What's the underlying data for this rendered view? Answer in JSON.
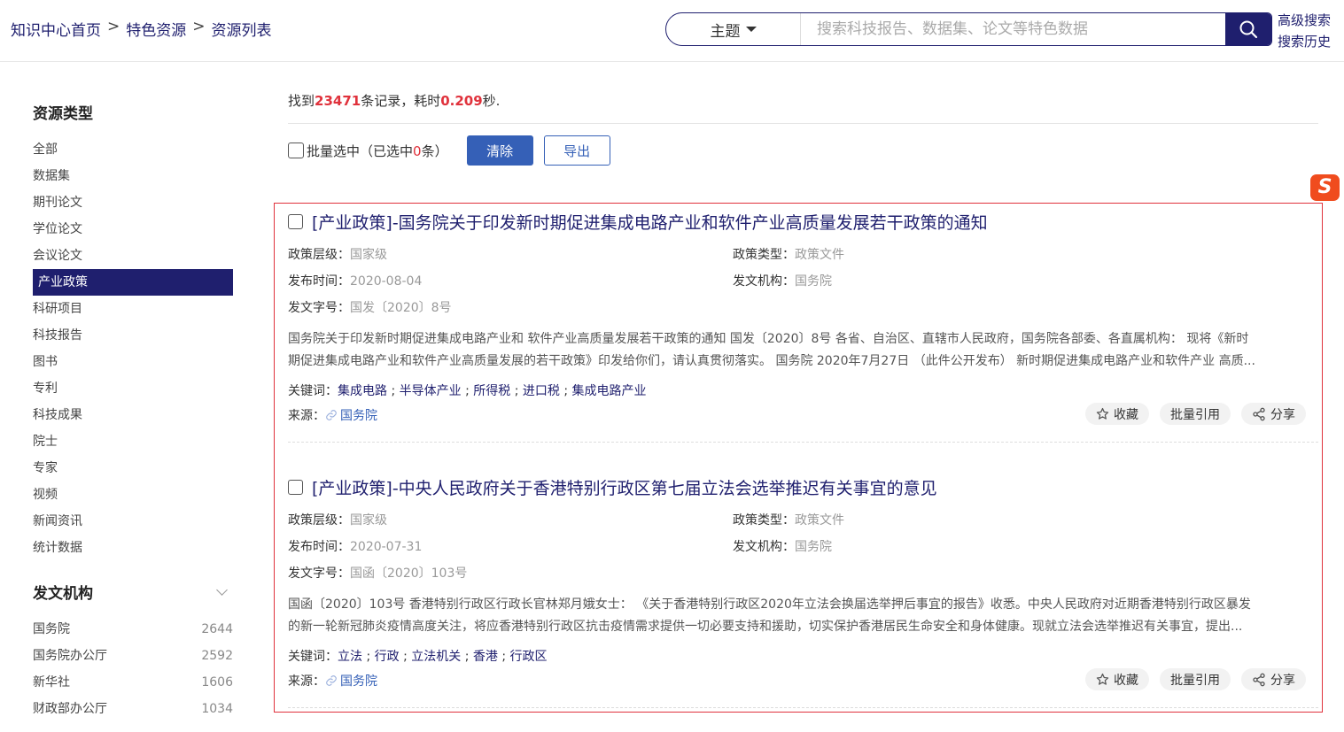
{
  "breadcrumb": {
    "home": "知识中心首页",
    "sep1": ">",
    "mid": "特色资源",
    "sep2": ">",
    "current": "资源列表"
  },
  "search": {
    "type_label": "主题",
    "placeholder": "搜索科技报告、数据集、论文等特色数据"
  },
  "top_links": {
    "advanced": "高级搜索",
    "history": "搜索历史"
  },
  "sidebar": {
    "type_title": "资源类型",
    "types": [
      "全部",
      "数据集",
      "期刊论文",
      "学位论文",
      "会议论文",
      "产业政策",
      "科研项目",
      "科技报告",
      "图书",
      "专利",
      "科技成果",
      "院士",
      "专家",
      "视频",
      "新闻资讯",
      "统计数据"
    ],
    "active_type": "产业政策",
    "org_title": "发文机构",
    "orgs": [
      {
        "name": "国务院",
        "count": "2644"
      },
      {
        "name": "国务院办公厅",
        "count": "2592"
      },
      {
        "name": "新华社",
        "count": "1606"
      },
      {
        "name": "财政部办公厅",
        "count": "1034"
      }
    ]
  },
  "summary": {
    "prefix": "找到",
    "count": "23471",
    "mid": "条记录，耗时",
    "time": "0.209",
    "suffix": "秒."
  },
  "toolbar": {
    "batch_prefix": "批量选中（已选中",
    "selected": "0",
    "batch_suffix": "条）",
    "clear": "清除",
    "export": "导出"
  },
  "sogou_icon": "S",
  "labels": {
    "level": "政策层级：",
    "ptype": "政策类型：",
    "date": "发布时间：",
    "org": "发文机构：",
    "docno": "发文字号：",
    "keywords": "关键词：",
    "source": "来源：",
    "favorite": "收藏",
    "cite": "批量引用",
    "share": "分享"
  },
  "results": [
    {
      "title": "[产业政策]-国务院关于印发新时期促进集成电路产业和软件产业高质量发展若干政策的通知",
      "level": "国家级",
      "ptype": "政策文件",
      "date": "2020-08-04",
      "org": "国务院",
      "docno": "国发〔2020〕8号",
      "abstract1": "国务院关于印发新时期促进集成电路产业和 软件产业高质量发展若干政策的通知 国发〔2020〕8号 各省、自治区、直辖市人民政府，国务院各部委、各直属机构： 现将《新时",
      "abstract2": "期促进集成电路产业和软件产业高质量发展的若干政策》印发给你们，请认真贯彻落实。 国务院 2020年7月27日 （此件公开发布） 新时期促进集成电路产业和软件产业 高质...",
      "keywords": [
        "集成电路",
        "半导体产业",
        "所得税",
        "进口税",
        "集成电路产业"
      ],
      "source": "国务院"
    },
    {
      "title": "[产业政策]-中央人民政府关于香港特别行政区第七届立法会选举推迟有关事宜的意见",
      "level": "国家级",
      "ptype": "政策文件",
      "date": "2020-07-31",
      "org": "国务院",
      "docno": "国函〔2020〕103号",
      "abstract1": "国函〔2020〕103号 香港特别行政区行政长官林郑月娥女士： 《关于香港特别行政区2020年立法会换届选举押后事宜的报告》收悉。中央人民政府对近期香港特别行政区暴发",
      "abstract2": "的新一轮新冠肺炎疫情高度关注，将应香港特别行政区抗击疫情需求提供一切必要支持和援助，切实保护香港居民生命安全和身体健康。现就立法会选举推迟有关事宜，提出...",
      "keywords": [
        "立法",
        "行政",
        "立法机关",
        "香港",
        "行政区"
      ],
      "source": "国务院"
    }
  ]
}
